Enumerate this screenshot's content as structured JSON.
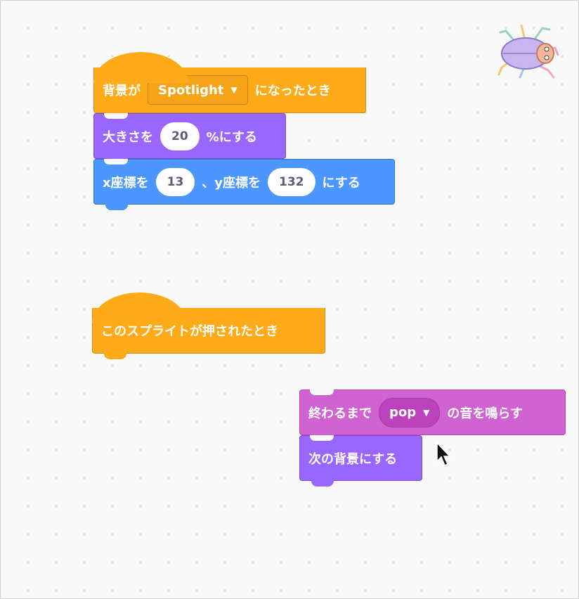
{
  "script1": {
    "hat": {
      "text_before": "背景が",
      "dropdown": "Spotlight",
      "text_after": "になったとき"
    },
    "size": {
      "text_before": "大きさを",
      "value": "20",
      "text_after": "%にする"
    },
    "goto": {
      "text1": "x座標を",
      "x": "13",
      "text2": "、y座標を",
      "y": "132",
      "text3": "にする"
    }
  },
  "script2": {
    "hat": {
      "text": "このスプライトが押されたとき"
    },
    "sound": {
      "text_before": "終わるまで",
      "dropdown": "pop",
      "text_after": "の音を鳴らす"
    },
    "next_backdrop": {
      "text": "次の背景にする"
    }
  },
  "colors": {
    "events": "#ffab19",
    "looks": "#9966ff",
    "motion": "#4c97ff",
    "sound": "#cf63cf"
  },
  "icons": {
    "dropdown_arrow": "▼",
    "sprite": "beetle-sprite-icon",
    "cursor": "mouse-pointer-icon"
  }
}
